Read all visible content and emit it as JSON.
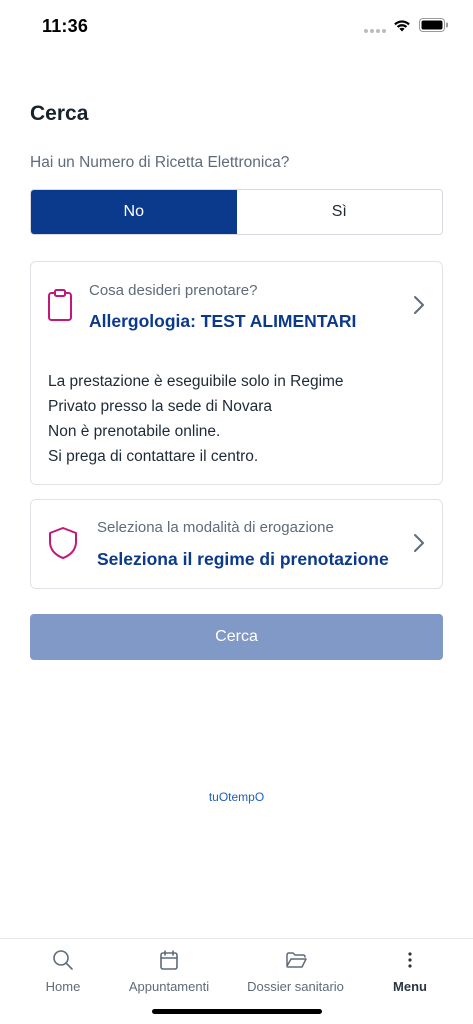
{
  "status": {
    "time": "11:36"
  },
  "header": {
    "title": "Cerca",
    "question": "Hai un Numero di Ricetta Elettronica?"
  },
  "segment": {
    "options": [
      "No",
      "Sì"
    ],
    "selected": "No"
  },
  "service_card": {
    "label": "Cosa desideri prenotare?",
    "value": "Allergologia: TEST ALIMENTARI",
    "note_lines": [
      "La prestazione è eseguibile solo in Regime",
      "Privato presso la sede di Novara",
      "Non è prenotabile online.",
      "Si prega di contattare il centro."
    ],
    "icon": "clipboard-icon"
  },
  "regime_card": {
    "label": "Seleziona la modalità di erogazione",
    "value": "Seleziona il regime di prenotazione",
    "icon": "shield-icon"
  },
  "search_button": {
    "label": "Cerca",
    "enabled": false
  },
  "brand": "tuOtempO",
  "tabbar": {
    "items": [
      {
        "label": "Home",
        "icon": "search-icon"
      },
      {
        "label": "Appuntamenti",
        "icon": "calendar-icon"
      },
      {
        "label": "Dossier sanitario",
        "icon": "folder-icon"
      },
      {
        "label": "Menu",
        "icon": "more-vertical-icon"
      }
    ]
  },
  "colors": {
    "primary": "#0b3a8c",
    "accent_icon": "#c2187a",
    "button_disabled": "#8199c6",
    "brand_link": "#1e5fbf"
  }
}
